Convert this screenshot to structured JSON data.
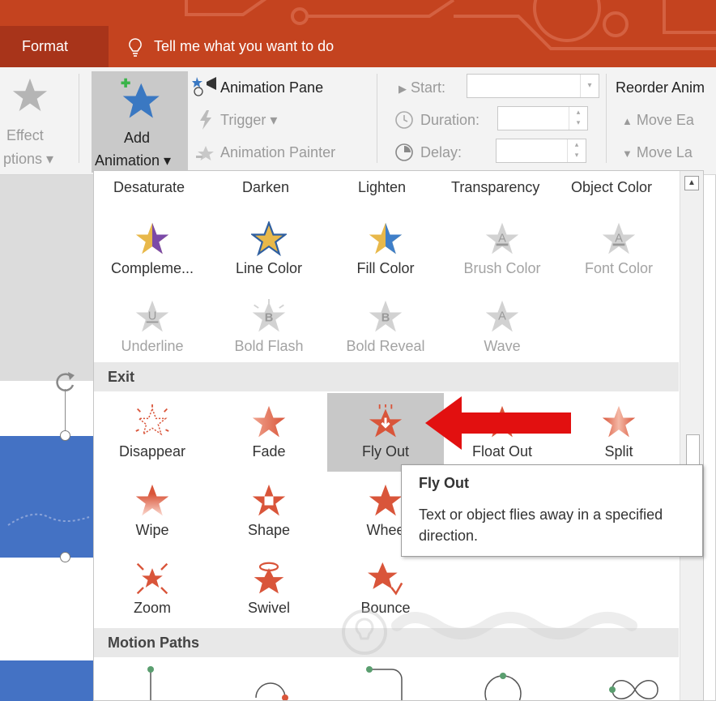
{
  "titlebar": {
    "tab_label": "Format",
    "tellme_text": "Tell me what you want to do",
    "bg_color": "#c4431f",
    "tab_color": "#a8341a"
  },
  "ribbon": {
    "effect_options_line1": "Effect",
    "effect_options_line2": "ptions",
    "add_animation_line1": "Add",
    "add_animation_line2": "Animation",
    "animation_pane": "Animation Pane",
    "trigger": "Trigger",
    "animation_painter": "Animation Painter",
    "start_label": "Start:",
    "duration_label": "Duration:",
    "delay_label": "Delay:",
    "reorder_label": "Reorder Anim",
    "move_earlier": "Move Ea",
    "move_later": "Move La"
  },
  "gallery": {
    "top_row": [
      "Desaturate",
      "Darken",
      "Lighten",
      "Transparency",
      "Object Color"
    ],
    "emphasis_row1": [
      {
        "label": "Compleme...",
        "icon": "complementary-star-icon",
        "enabled": true
      },
      {
        "label": "Line Color",
        "icon": "line-color-star-icon",
        "enabled": true
      },
      {
        "label": "Fill Color",
        "icon": "fill-color-star-icon",
        "enabled": true
      },
      {
        "label": "Brush Color",
        "icon": "brush-color-star-icon",
        "enabled": false
      },
      {
        "label": "Font Color",
        "icon": "font-color-star-icon",
        "enabled": false
      }
    ],
    "emphasis_row2": [
      {
        "label": "Underline",
        "icon": "underline-star-icon",
        "enabled": false
      },
      {
        "label": "Bold Flash",
        "icon": "bold-flash-star-icon",
        "enabled": false
      },
      {
        "label": "Bold Reveal",
        "icon": "bold-reveal-star-icon",
        "enabled": false
      },
      {
        "label": "Wave",
        "icon": "wave-star-icon",
        "enabled": false
      }
    ],
    "exit_section": "Exit",
    "exit_row1": [
      {
        "label": "Disappear",
        "icon": "disappear-star-icon"
      },
      {
        "label": "Fade",
        "icon": "fade-star-icon"
      },
      {
        "label": "Fly Out",
        "icon": "fly-out-star-icon",
        "highlighted": true
      },
      {
        "label": "Float Out",
        "icon": "float-out-star-icon"
      },
      {
        "label": "Split",
        "icon": "split-star-icon"
      }
    ],
    "exit_row2": [
      {
        "label": "Wipe",
        "icon": "wipe-star-icon"
      },
      {
        "label": "Shape",
        "icon": "shape-star-icon"
      },
      {
        "label": "Whee",
        "icon": "wheel-star-icon"
      }
    ],
    "exit_row3": [
      {
        "label": "Zoom",
        "icon": "zoom-star-icon"
      },
      {
        "label": "Swivel",
        "icon": "swivel-star-icon"
      },
      {
        "label": "Bounce",
        "icon": "bounce-star-icon"
      }
    ],
    "motion_section": "Motion Paths"
  },
  "tooltip": {
    "title": "Fly Out",
    "body": "Text or object flies away in a specified direction."
  },
  "colors": {
    "exit_red": "#d9553a",
    "emphasis_gold": "#e8b84a",
    "emphasis_purple": "#7b4aa8",
    "emphasis_blue": "#3f7fc9",
    "disabled_gray": "#c8c8c8",
    "slide_blue": "#4472c4",
    "highlight_gray": "#c8c8c8",
    "arrow_red": "#e21010"
  }
}
